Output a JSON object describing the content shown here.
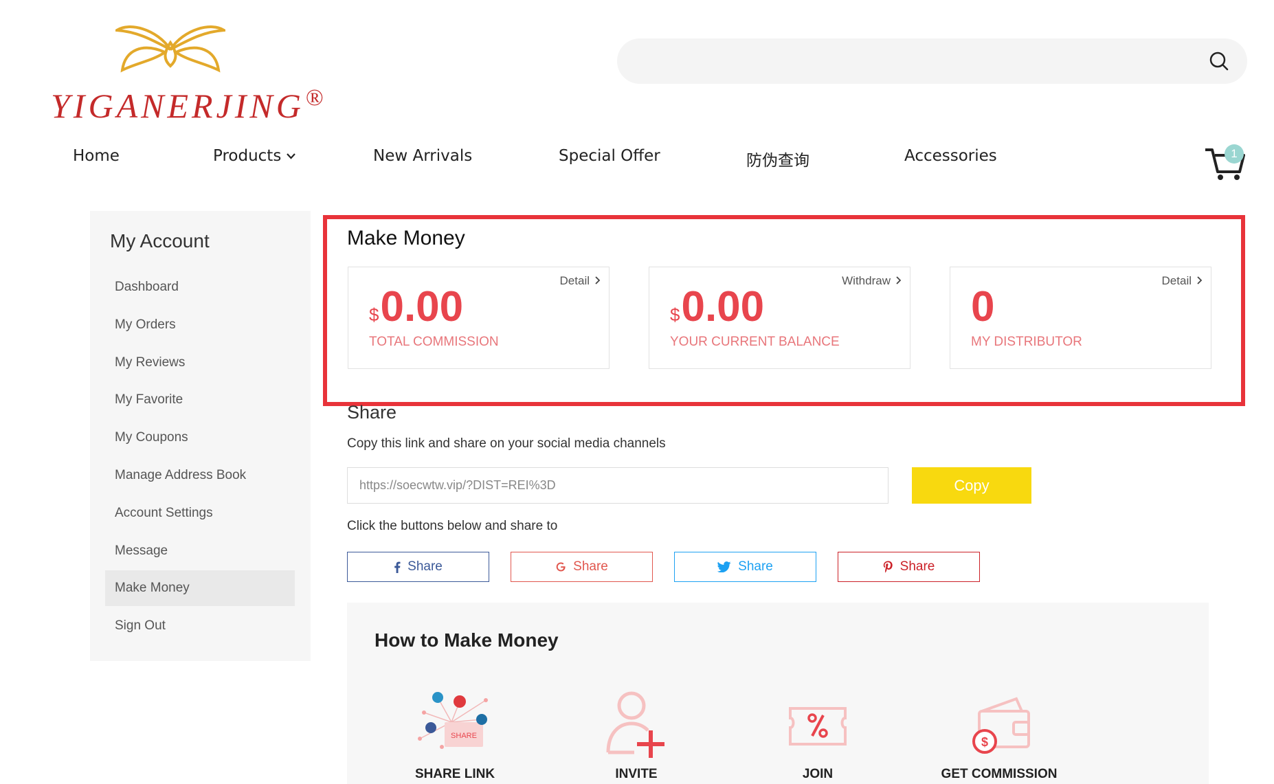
{
  "brand": {
    "name": "YIGANERJING",
    "reg_mark": "®",
    "color": "#c42a2a",
    "accent": "#e3a92b"
  },
  "search": {
    "placeholder": "",
    "icon": "search-icon"
  },
  "nav": {
    "items": [
      "Home",
      "Products",
      "New Arrivals",
      "Special Offer",
      "防伪查询",
      "Accessories"
    ],
    "cart_count": "1"
  },
  "sidebar": {
    "title": "My Account",
    "items": [
      "Dashboard",
      "My Orders",
      "My Reviews",
      "My Favorite",
      "My Coupons",
      "Manage Address Book",
      "Account Settings",
      "Message",
      "Make Money",
      "Sign Out"
    ],
    "active": "Make Money"
  },
  "make_money": {
    "title": "Make Money",
    "stats": [
      {
        "currency": "$",
        "value": "0.00",
        "label": "TOTAL COMMISSION",
        "link": "Detail"
      },
      {
        "currency": "$",
        "value": "0.00",
        "label": "YOUR CURRENT BALANCE",
        "link": "Withdraw"
      },
      {
        "currency": "",
        "value": "0",
        "label": "MY DISTRIBUTOR",
        "link": "Detail"
      }
    ]
  },
  "share": {
    "title": "Share",
    "instruction": "Copy this link and share on your social media channels",
    "link_value": "https://soecwtw.vip/?DIST=REI%3D",
    "copy_label": "Copy",
    "instruction2": "Click the buttons below and share to",
    "buttons": [
      {
        "icon": "facebook-icon",
        "label": "Share",
        "color": "#3b5998"
      },
      {
        "icon": "google-icon",
        "label": "Share",
        "color": "#e1574e"
      },
      {
        "icon": "twitter-icon",
        "label": "Share",
        "color": "#1da1f2"
      },
      {
        "icon": "pinterest-icon",
        "label": "Share",
        "color": "#cb2027"
      }
    ]
  },
  "how_to": {
    "title": "How to Make Money",
    "steps": [
      {
        "label": "SHARE LINK",
        "icon": "share-network-icon",
        "badge": "SHARE"
      },
      {
        "label": "INVITE",
        "icon": "invite-user-icon"
      },
      {
        "label": "JOIN",
        "icon": "percent-ticket-icon"
      },
      {
        "label": "GET COMMISSION",
        "icon": "wallet-commission-icon"
      }
    ]
  },
  "colors": {
    "highlight": "#e8333a",
    "stat_value": "#e8454d",
    "copy_button": "#f8d90f"
  }
}
